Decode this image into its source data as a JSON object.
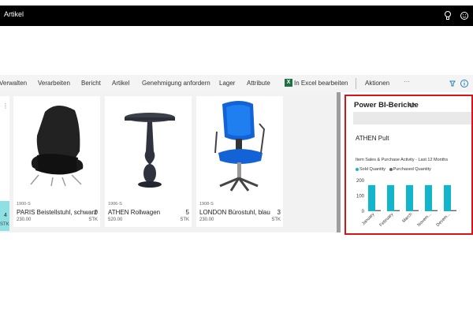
{
  "window": {
    "title": "Artikel"
  },
  "header_icons": [
    "lightbulb-icon",
    "smiley-icon"
  ],
  "actions": [
    "Verwalten",
    "Verarbeiten",
    "Bericht",
    "Artikel",
    "Genehmigung anfordern",
    "Lager",
    "Attribute",
    "In Excel bearbeiten",
    "Aktionen",
    "···"
  ],
  "excel_icon_letter": "X",
  "left_strip": {
    "qty": "4",
    "unit": "STK"
  },
  "items": [
    {
      "no": "1900-S",
      "name": "PARIS Beistellstuhl, schwarz",
      "qty": "0",
      "price": "230.00",
      "unit": "STK"
    },
    {
      "no": "1906-S",
      "name": "ATHEN Rollwagen",
      "qty": "5",
      "price": "520.00",
      "unit": "STK"
    },
    {
      "no": "1908-S",
      "name": "LONDON Bürostuhl, blau",
      "qty": "3",
      "price": "230.00",
      "unit": "STK"
    }
  ],
  "powerbi": {
    "title": "Power BI-Berichte",
    "subtitle": "ATHEN Pult"
  },
  "colors": {
    "accent_red": "#d6141c",
    "teal": "#12b5c9",
    "gray_bar": "#5b6670"
  },
  "chart_data": {
    "type": "bar",
    "title": "Item Sales & Purchase Activity - Last 12 Months",
    "categories": [
      "January",
      "February",
      "March",
      "Novem...",
      "Decem..."
    ],
    "series": [
      {
        "name": "Sold Quantity",
        "values": [
          170,
          170,
          170,
          170,
          170
        ]
      },
      {
        "name": "Purchased Quantity",
        "values": [
          2,
          2,
          2,
          2,
          2
        ]
      }
    ],
    "yticks": [
      "200",
      "100",
      "0"
    ],
    "ylim": [
      0,
      200
    ],
    "legend": "top-left"
  }
}
